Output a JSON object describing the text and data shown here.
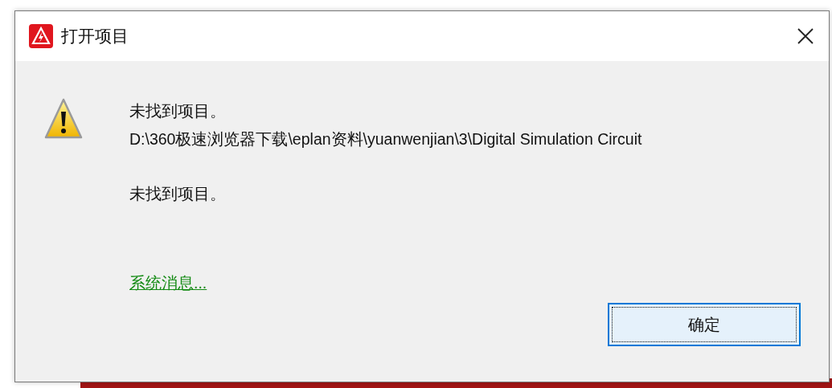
{
  "window": {
    "title": "打开项目"
  },
  "message": {
    "lines": [
      "未找到项目。",
      "D:\\360极速浏览器下载\\eplan资料\\yuanwenjian\\3\\Digital Simulation Circuit"
    ],
    "detail": "未找到项目。"
  },
  "link": "系统消息...",
  "buttons": [
    {
      "label": "确定",
      "focused": true
    }
  ]
}
